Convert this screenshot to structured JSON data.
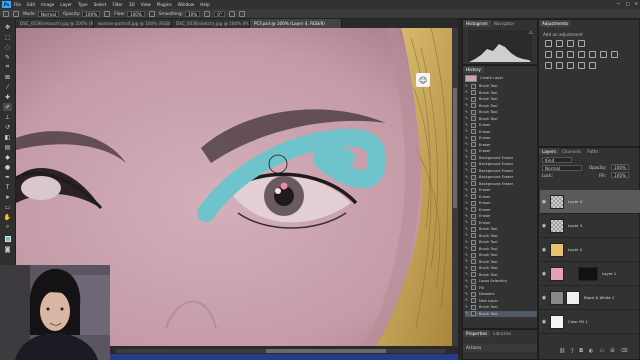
{
  "menubar": {
    "logo": "Ps",
    "items": [
      "File",
      "Edit",
      "Image",
      "Layer",
      "Type",
      "Select",
      "Filter",
      "3D",
      "View",
      "Plugins",
      "Window",
      "Help"
    ],
    "window_controls": [
      "—",
      "□",
      "✕"
    ]
  },
  "options": {
    "opacity_label": "Opacity:",
    "opacity_value": "100%",
    "mode_label": "Mode:",
    "mode_value": "Normal",
    "flow_label": "Flow:",
    "flow_value": "100%",
    "smoothing_label": "Smoothing:",
    "smoothing_value": "10%",
    "angle_value": "0°"
  },
  "tabs": [
    {
      "label": "DSC_0536(retouch).jpg @ 100% (RGB/8)",
      "active": false
    },
    {
      "label": "woman-portrait.jpg @ 100% (RGB/8)",
      "active": false
    },
    {
      "label": "DSC_0536(sketch).jpg @ 100% (RGB/8)",
      "active": false
    },
    {
      "label": "PCF.psd @ 100% (Layer 4, RGB/8)",
      "active": true
    }
  ],
  "histogram_panel": {
    "tabs": [
      "Histogram",
      "Navigator"
    ],
    "warning_icon": "⚠"
  },
  "history_panel": {
    "tab": "History",
    "snapshot": "Create Layer",
    "items": [
      "Brush Tool",
      "Brush Tool",
      "Brush Tool",
      "Brush Tool",
      "Brush Tool",
      "Brush Tool",
      "Eraser",
      "Eraser",
      "Eraser",
      "Eraser",
      "Eraser",
      "Background Eraser",
      "Background Eraser",
      "Background Eraser",
      "Background Eraser",
      "Background Eraser",
      "Eraser",
      "Eraser",
      "Eraser",
      "Eraser",
      "Eraser",
      "Eraser",
      "Brush Tool",
      "Brush Tool",
      "Brush Tool",
      "Brush Tool",
      "Brush Tool",
      "Brush Tool",
      "Brush Tool",
      "Brush Tool",
      "Lasso Selection",
      "Fill",
      "Deselect",
      "New Layer",
      "Brush Tool",
      "Brush Tool"
    ]
  },
  "properties_panel": {
    "tabs": [
      "Properties",
      "Libraries"
    ],
    "actions_tab": "Actions"
  },
  "adjustments_panel": {
    "tabs": [
      "Adjustments"
    ],
    "add_label": "Add an adjustment"
  },
  "layers_panel": {
    "tabs": [
      "Layers",
      "Channels",
      "Paths"
    ],
    "filter_kind": "Kind",
    "blend_mode": "Normal",
    "opacity_label": "Opacity:",
    "opacity_value": "100%",
    "lock_label": "Lock:",
    "fill_label": "Fill:",
    "fill_value": "100%",
    "layers": [
      {
        "name": "Layer 4",
        "selected": true
      },
      {
        "name": "Layer 3",
        "selected": false
      },
      {
        "name": "Layer 2",
        "selected": false
      },
      {
        "name": "Layer 1",
        "selected": false
      },
      {
        "name": "Black & White 1",
        "selected": false
      },
      {
        "name": "Color Fill 1",
        "selected": false
      }
    ]
  },
  "colors": {
    "skin_tint": "#c9a3ae",
    "brush_cyan": "#6fc4cc",
    "hair_gold": "#d4b060",
    "accent": "#31a8ff"
  }
}
